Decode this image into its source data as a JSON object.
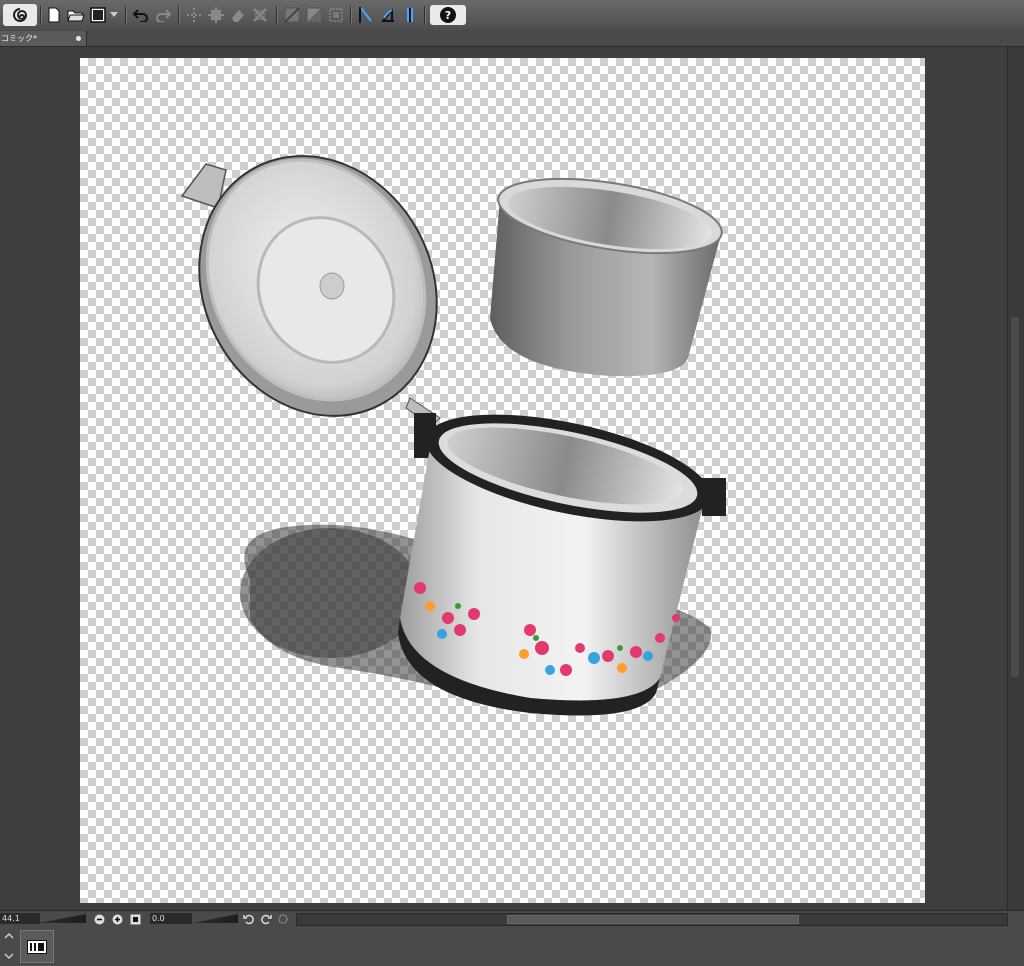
{
  "toolbar": {
    "buttons": [
      {
        "name": "app-menu-icon"
      },
      {
        "name": "new-file-icon"
      },
      {
        "name": "open-file-icon"
      },
      {
        "name": "save-icon"
      },
      {
        "name": "undo-icon"
      },
      {
        "name": "redo-icon"
      },
      {
        "name": "transform-icon"
      },
      {
        "name": "fit-icon"
      },
      {
        "name": "erase-icon"
      },
      {
        "name": "crop-icon"
      },
      {
        "name": "snap-ruler-icon"
      },
      {
        "name": "snap-special-icon"
      },
      {
        "name": "snap-grid-icon"
      },
      {
        "name": "help-icon"
      }
    ],
    "help_label": "?"
  },
  "tab": {
    "label": "コミック*"
  },
  "status": {
    "zoom_value": "44.1",
    "rotation_value": "0.0"
  },
  "colors": {
    "toolbar_bg": "#5a5a5a",
    "canvas_surround": "#3e3e3e",
    "checker": "#cfcfcf"
  }
}
